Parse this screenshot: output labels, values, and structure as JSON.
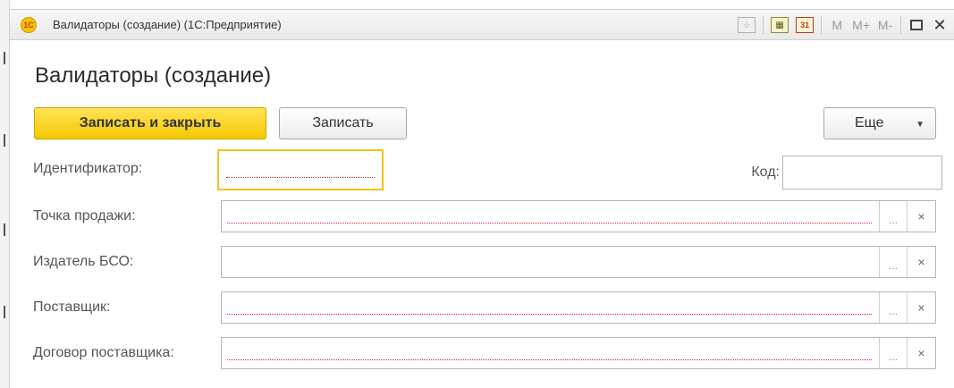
{
  "window": {
    "title": "Валидаторы (создание) (1С:Предприятие)",
    "logo_text": "1С",
    "toolbar": {
      "m_label": "M",
      "m_plus_label": "M+",
      "m_minus_label": "M-",
      "calendar_day": "31",
      "close_glyph": "✕"
    }
  },
  "form": {
    "title": "Валидаторы (создание)",
    "buttons": {
      "save_close": "Записать и закрыть",
      "save": "Записать",
      "more": "Еще"
    },
    "fields": {
      "identifier": {
        "label": "Идентификатор:",
        "value": ""
      },
      "code": {
        "label": "Код:",
        "value": ""
      },
      "sale_point": {
        "label": "Точка продажи:",
        "value": ""
      },
      "bso_publisher": {
        "label": "Издатель БСО:",
        "value": ""
      },
      "supplier": {
        "label": "Поставщик:",
        "value": ""
      },
      "supplier_contract": {
        "label": "Договор поставщика:",
        "value": ""
      }
    },
    "select_glyph": "...",
    "clear_glyph": "×"
  },
  "colors": {
    "primary_button": "#f3c800",
    "required_underline": "#d2232a",
    "focus_border": "#f1c31a"
  }
}
